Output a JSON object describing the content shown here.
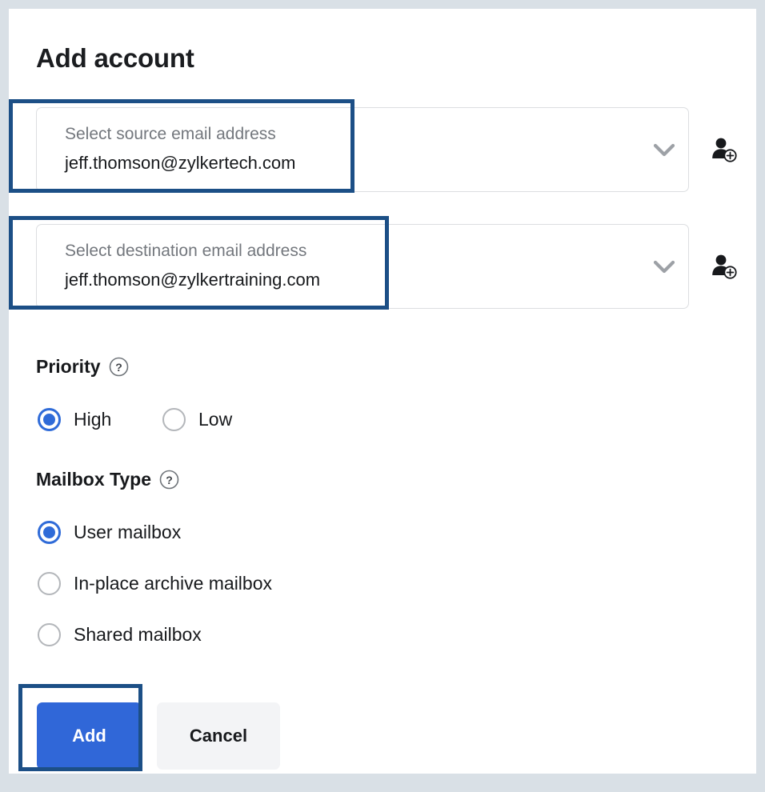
{
  "dialog": {
    "title": "Add account"
  },
  "fields": [
    {
      "name": "source-email",
      "label": "Select source email address",
      "value": "jeff.thomson@zylkertech.com",
      "chevron_icon": "chevron-down-icon",
      "action_icon": "add-user-icon",
      "highlighted": true
    },
    {
      "name": "destination-email",
      "label": "Select destination email address",
      "value": "jeff.thomson@zylkertraining.com",
      "chevron_icon": "chevron-down-icon",
      "action_icon": "add-user-icon",
      "highlighted": true
    }
  ],
  "priority": {
    "heading": "Priority",
    "help_icon": "help-circle-icon",
    "options": [
      {
        "label": "High",
        "selected": true
      },
      {
        "label": "Low",
        "selected": false
      }
    ]
  },
  "mailbox_type": {
    "heading": "Mailbox Type",
    "help_icon": "help-circle-icon",
    "options": [
      {
        "label": "User mailbox",
        "selected": true
      },
      {
        "label": "In-place archive mailbox",
        "selected": false
      },
      {
        "label": "Shared mailbox",
        "selected": false
      }
    ]
  },
  "footer": {
    "add_label": "Add",
    "cancel_label": "Cancel"
  },
  "colors": {
    "primary_button": "#3067d8",
    "radio_selected": "#2f6bd8",
    "annotation_outline": "#1c4f86",
    "page_background": "#d9e0e6",
    "card_background": "#ffffff",
    "secondary_button": "#f3f4f6",
    "label_gray": "#73777d"
  }
}
